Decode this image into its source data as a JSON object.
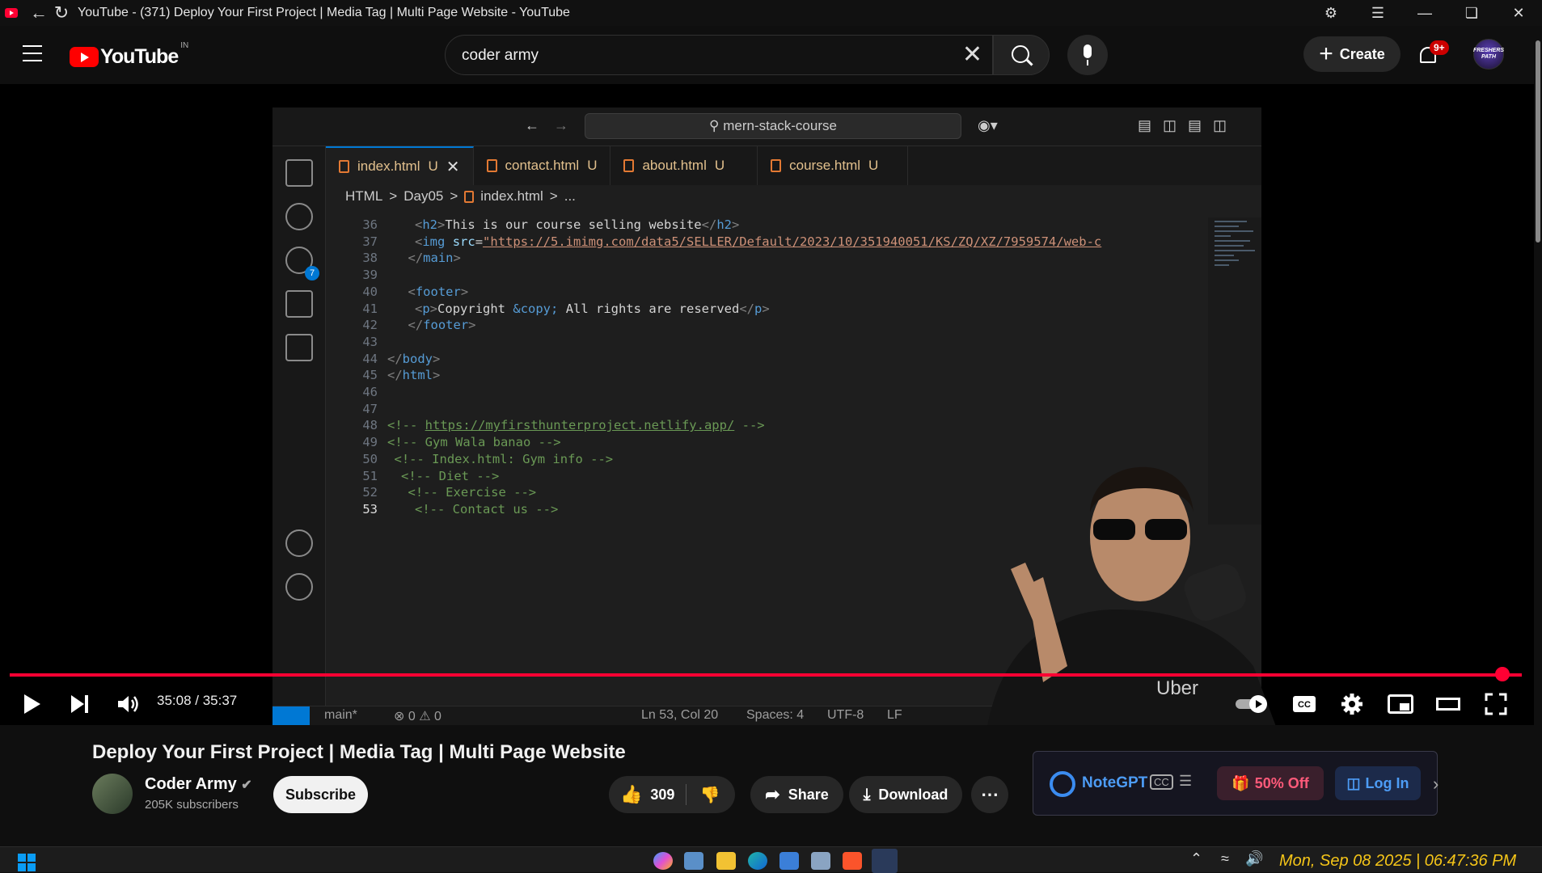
{
  "browser": {
    "title": "YouTube - (371) Deploy Your First Project | Media Tag | Multi Page Website - YouTube"
  },
  "header": {
    "logo_text": "YouTube",
    "country": "IN",
    "search_value": "coder army",
    "create_label": "Create",
    "notif_badge": "9+",
    "avatar_text": "FRESHERS PATH"
  },
  "vscode": {
    "command_center": "mern-stack-course",
    "tabs": [
      {
        "name": "index.html",
        "status": "U"
      },
      {
        "name": "contact.html",
        "status": "U"
      },
      {
        "name": "about.html",
        "status": "U"
      },
      {
        "name": "course.html",
        "status": "U"
      }
    ],
    "breadcrumb": [
      "HTML",
      ">",
      "Day05",
      ">",
      "index.html",
      ">",
      "..."
    ],
    "scm_badge": "7",
    "lines": [
      {
        "n": "36",
        "html": "<span class=\"br\">&lt;</span><span class=\"tg\">h2</span><span class=\"br\">&gt;</span>This is our course selling website<span class=\"br\">&lt;/</span><span class=\"tg\">h2</span><span class=\"br\">&gt;</span>",
        "indent": 4
      },
      {
        "n": "37",
        "html": "<span class=\"br\">&lt;</span><span class=\"tg\">img</span> <span class=\"at\">src</span>=<span class=\"st\">\"https://5.imimg.com/data5/SELLER/Default/2023/10/351940051/KS/ZQ/XZ/7959574/web-c</span>",
        "indent": 4
      },
      {
        "n": "38",
        "html": "<span class=\"br\">&lt;/</span><span class=\"tg\">main</span><span class=\"br\">&gt;</span>",
        "indent": 3
      },
      {
        "n": "39",
        "html": "",
        "indent": 0
      },
      {
        "n": "40",
        "html": "<span class=\"br\">&lt;</span><span class=\"tg\">footer</span><span class=\"br\">&gt;</span>",
        "indent": 3
      },
      {
        "n": "41",
        "html": "<span class=\"br\">&lt;</span><span class=\"tg\">p</span><span class=\"br\">&gt;</span>Copyright <span class=\"tg\">&amp;copy;</span> All rights are reserved<span class=\"br\">&lt;/</span><span class=\"tg\">p</span><span class=\"br\">&gt;</span>",
        "indent": 4
      },
      {
        "n": "42",
        "html": "<span class=\"br\">&lt;/</span><span class=\"tg\">footer</span><span class=\"br\">&gt;</span>",
        "indent": 3
      },
      {
        "n": "43",
        "html": "",
        "indent": 0
      },
      {
        "n": "44",
        "html": "<span class=\"br\">&lt;/</span><span class=\"tg\">body</span><span class=\"br\">&gt;</span>",
        "indent": 0
      },
      {
        "n": "45",
        "html": "<span class=\"br\">&lt;/</span><span class=\"tg\">html</span><span class=\"br\">&gt;</span>",
        "indent": 0
      },
      {
        "n": "46",
        "html": "",
        "indent": 0
      },
      {
        "n": "47",
        "html": "",
        "indent": 0
      },
      {
        "n": "48",
        "html": "<span class=\"cm\">&lt;!-- <u>https://myfirsthunterproject.netlify.app/</u> --&gt;</span>",
        "indent": 0
      },
      {
        "n": "49",
        "html": "<span class=\"cm\">&lt;!-- Gym Wala banao --&gt;</span>",
        "indent": 0
      },
      {
        "n": "50",
        "html": "<span class=\"cm\">&lt;!-- Index.html: Gym info --&gt;</span>",
        "indent": 1
      },
      {
        "n": "51",
        "html": "<span class=\"cm\">&lt;!-- Diet --&gt;</span>",
        "indent": 2
      },
      {
        "n": "52",
        "html": "<span class=\"cm\">&lt;!-- Exercise --&gt;</span>",
        "indent": 3
      },
      {
        "n": "53",
        "html": "<span class=\"cm\">&lt;!-- Contact us --&gt;</span>",
        "indent": 4
      }
    ],
    "status": {
      "branch": "main*",
      "problems": "⊗ 0 ⚠ 0",
      "position": "Ln 53, Col 20",
      "spaces": "Spaces: 4",
      "encoding": "UTF-8",
      "eol": "LF"
    },
    "overlay_text": "Uber"
  },
  "player": {
    "time": "35:08 / 35:37",
    "progress": 0.987
  },
  "video": {
    "title": "Deploy Your First Project | Media Tag | Multi Page Website",
    "channel": "Coder Army",
    "subscribers": "205K subscribers",
    "subscribe_label": "Subscribe",
    "likes": "309",
    "share_label": "Share",
    "download_label": "Download"
  },
  "notegpt": {
    "name": "NoteGPT",
    "offer": "50% Off",
    "login": "Log In"
  },
  "taskbar": {
    "clock": "Mon, Sep 08 2025 | 06:47:36 PM"
  },
  "colors": {
    "yt_red": "#ff0033",
    "vscode_blue": "#0078d4",
    "clock_yellow": "#f5c518"
  }
}
